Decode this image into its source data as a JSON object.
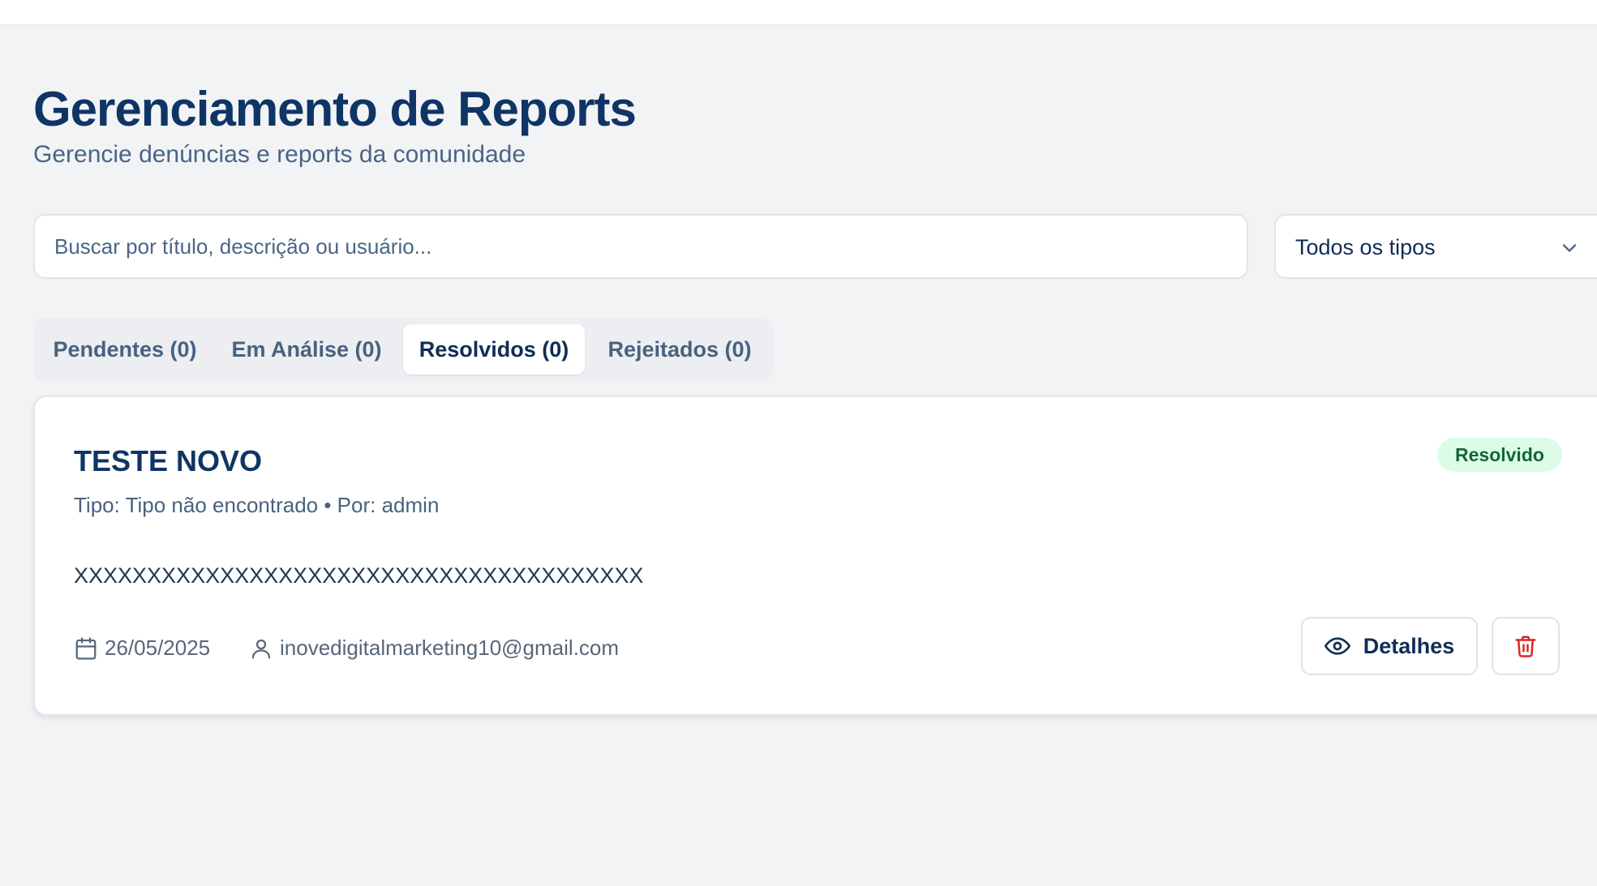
{
  "header": {
    "title": "Gerenciamento de Reports",
    "subtitle": "Gerencie denúncias e reports da comunidade"
  },
  "filters": {
    "search_placeholder": "Buscar por título, descrição ou usuário...",
    "search_value": "",
    "type_select": {
      "selected": "Todos os tipos"
    }
  },
  "tabs": [
    {
      "label": "Pendentes (0)",
      "active": false
    },
    {
      "label": "Em Análise (0)",
      "active": false
    },
    {
      "label": "Resolvidos (0)",
      "active": true
    },
    {
      "label": "Rejeitados (0)",
      "active": false
    }
  ],
  "reports": [
    {
      "title": "TESTE NOVO",
      "status": "Resolvido",
      "meta": "Tipo: Tipo não encontrado • Por: admin",
      "description": "XXXXXXXXXXXXXXXXXXXXXXXXXXXXXXXXXXXXXXX",
      "date": "26/05/2025",
      "email": "inovedigitalmarketing10@gmail.com",
      "details_label": "Detalhes"
    }
  ],
  "icons": {
    "chevron": "chevron-down-icon",
    "calendar": "calendar-icon",
    "user": "user-icon",
    "eye": "eye-icon",
    "trash": "trash-icon"
  },
  "colors": {
    "primary_text": "#0f3566",
    "muted_text": "#48627f",
    "background": "#f2f3f5",
    "status_resolved_bg": "#dcfce7",
    "status_resolved_text": "#166534",
    "danger": "#dc2626"
  }
}
